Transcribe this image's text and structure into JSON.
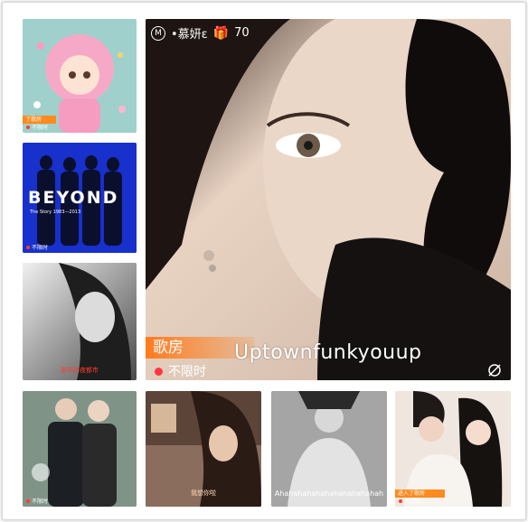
{
  "main": {
    "host_name": "•慕妍ε",
    "gift_count": "70",
    "room_label": "歌房",
    "song": "Uptownfunkyouup",
    "status": "不限时"
  },
  "tiles": {
    "t1": {
      "caption": "",
      "badge": "了歌房",
      "status": "不限时"
    },
    "t2": {
      "title": "BEYOND",
      "subtitle": "The Story 1983—2013",
      "status": "不限时"
    },
    "t3": {
      "caption": "絮华的夜都市"
    },
    "t4": {
      "status": "不限时"
    },
    "t5": {
      "caption": "我想你啦"
    },
    "t6": {
      "caption": "Ahahahahahahahahahahahah"
    },
    "t7": {
      "badge": "进入了歌房",
      "status": "不限时"
    }
  }
}
